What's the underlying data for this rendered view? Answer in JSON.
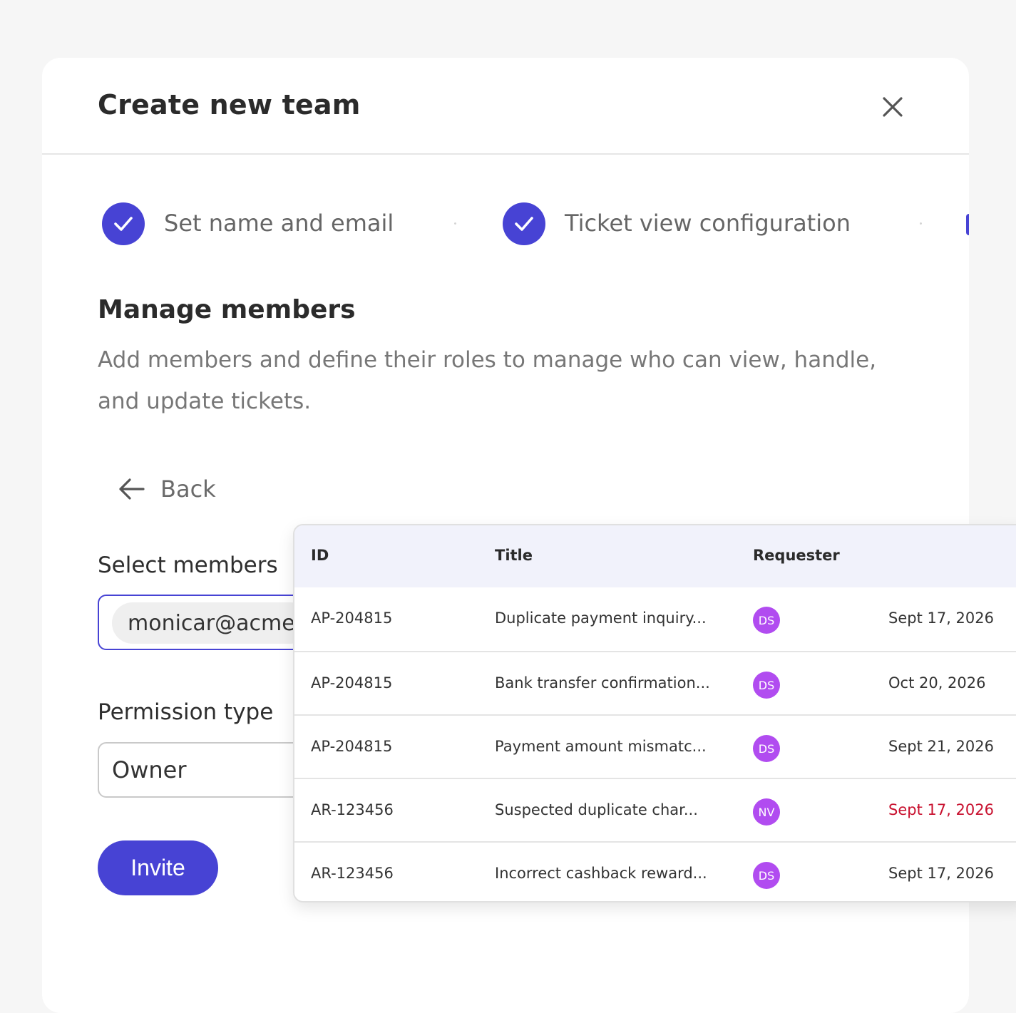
{
  "modal": {
    "title": "Create new team"
  },
  "stepper": {
    "steps": [
      {
        "label": "Set name and email",
        "status": "completed"
      },
      {
        "label": "Ticket view configuration",
        "status": "completed"
      }
    ]
  },
  "section": {
    "title": "Manage members",
    "description": "Add members and define their roles to manage who can view, handle, and update tickets."
  },
  "back": {
    "label": "Back"
  },
  "form": {
    "members_label": "Select members",
    "members_chip": "monicar@acme",
    "permission_label": "Permission type",
    "permission_value": "Owner",
    "invite_label": "Invite"
  },
  "table": {
    "headers": [
      "ID",
      "Title",
      "Requester"
    ],
    "rows": [
      {
        "id": "AP-204815",
        "title": "Duplicate payment inquiry...",
        "requester": "DS",
        "date": "Sept 17, 2026",
        "date_overdue": false
      },
      {
        "id": "AP-204815",
        "title": "Bank transfer confirmation...",
        "requester": "DS",
        "date": "Oct 20, 2026",
        "date_overdue": false
      },
      {
        "id": "AP-204815",
        "title": "Payment amount mismatc...",
        "requester": "DS",
        "date": "Sept 21, 2026",
        "date_overdue": false
      },
      {
        "id": "AR-123456",
        "title": "Suspected duplicate char...",
        "requester": "NV",
        "date": "Sept 17, 2026",
        "date_overdue": true
      },
      {
        "id": "AR-123456",
        "title": "Incorrect cashback reward...",
        "requester": "DS",
        "date": "Sept 17, 2026",
        "date_overdue": false
      }
    ]
  },
  "colors": {
    "accent": "#4743d4",
    "avatar": "#b14cf0",
    "overdue": "#c8102e"
  },
  "icons": {
    "close": "close-icon",
    "check": "check-icon",
    "back": "arrow-left-icon"
  }
}
